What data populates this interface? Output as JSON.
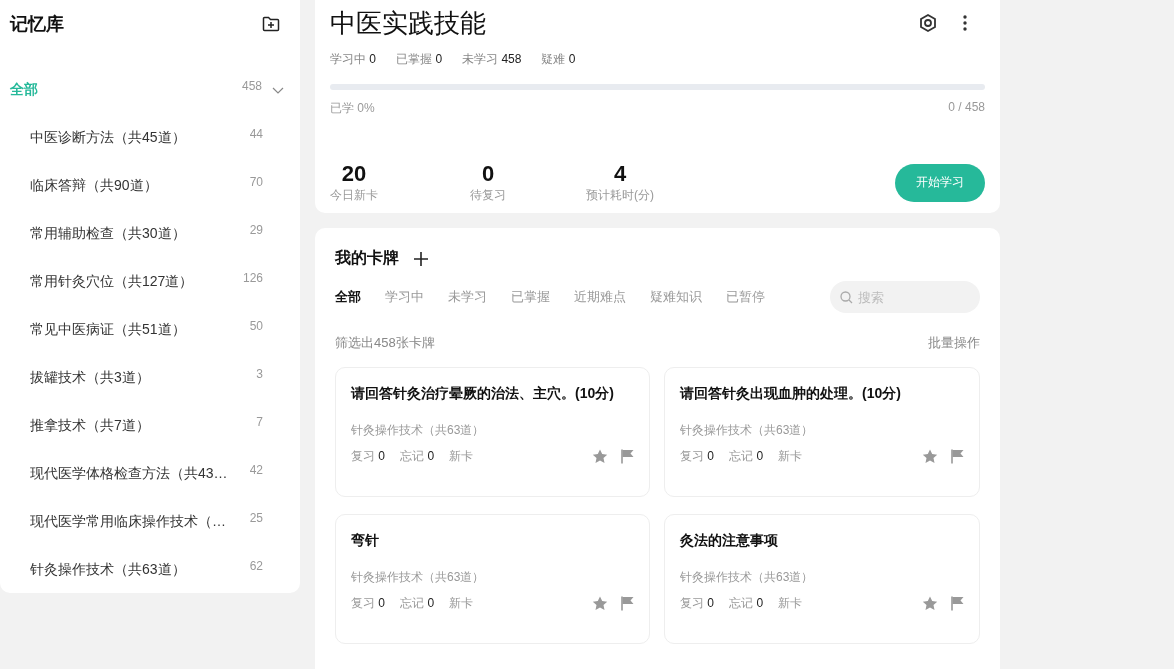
{
  "sidebar": {
    "title": "记忆库",
    "items": [
      {
        "label": "全部",
        "count": "458",
        "selected": true,
        "expanded": true
      },
      {
        "label": "中医诊断方法（共45道）",
        "count": "44",
        "selected": false
      },
      {
        "label": "临床答辩（共90道）",
        "count": "70",
        "selected": false
      },
      {
        "label": "常用辅助检查（共30道）",
        "count": "29",
        "selected": false
      },
      {
        "label": "常用针灸穴位（共127道）",
        "count": "126",
        "selected": false
      },
      {
        "label": "常见中医病证（共51道）",
        "count": "50",
        "selected": false
      },
      {
        "label": "拔罐技术（共3道）",
        "count": "3",
        "selected": false
      },
      {
        "label": "推拿技术（共7道）",
        "count": "7",
        "selected": false
      },
      {
        "label": "现代医学体格检查方法（共43…",
        "count": "42",
        "selected": false
      },
      {
        "label": "现代医学常用临床操作技术（…",
        "count": "25",
        "selected": false
      },
      {
        "label": "针灸操作技术（共63道）",
        "count": "62",
        "selected": false
      }
    ]
  },
  "deck": {
    "title": "中医实践技能",
    "status": [
      {
        "label": "学习中",
        "value": "0"
      },
      {
        "label": "已掌握",
        "value": "0"
      },
      {
        "label": "未学习",
        "value": "458"
      },
      {
        "label": "疑难",
        "value": "0"
      }
    ],
    "progress": {
      "level": 0,
      "label": "已学 0%",
      "reading": "0 / 458"
    },
    "stats": [
      {
        "value": "20",
        "label": "今日新卡"
      },
      {
        "value": "0",
        "label": "待复习"
      },
      {
        "value": "4",
        "label": "预计耗时(分)"
      }
    ],
    "start_button": "开始学习"
  },
  "cards_panel": {
    "title": "我的卡牌",
    "tabs": [
      {
        "label": "全部",
        "selected": true
      },
      {
        "label": "学习中",
        "selected": false
      },
      {
        "label": "未学习",
        "selected": false
      },
      {
        "label": "已掌握",
        "selected": false
      },
      {
        "label": "近期难点",
        "selected": false
      },
      {
        "label": "疑难知识",
        "selected": false
      },
      {
        "label": "已暂停",
        "selected": false
      }
    ],
    "search": {
      "placeholder": "搜索"
    },
    "filter_summary": "筛选出458张卡牌",
    "batch_action": "批量操作",
    "cards": [
      {
        "title": "请回答针灸治疗晕厥的治法、主穴。(10分)",
        "deck": "针灸操作技术（共63道）",
        "review": "复习",
        "review_count": "0",
        "forget": "忘记",
        "forget_count": "0",
        "tag": "新卡"
      },
      {
        "title": "请回答针灸出现血肿的处理。(10分)",
        "deck": "针灸操作技术（共63道）",
        "review": "复习",
        "review_count": "0",
        "forget": "忘记",
        "forget_count": "0",
        "tag": "新卡"
      },
      {
        "title": "弯针",
        "deck": "针灸操作技术（共63道）",
        "review": "复习",
        "review_count": "0",
        "forget": "忘记",
        "forget_count": "0",
        "tag": "新卡"
      },
      {
        "title": "灸法的注意事项",
        "deck": "针灸操作技术（共63道）",
        "review": "复习",
        "review_count": "0",
        "forget": "忘记",
        "forget_count": "0",
        "tag": "新卡"
      }
    ]
  }
}
